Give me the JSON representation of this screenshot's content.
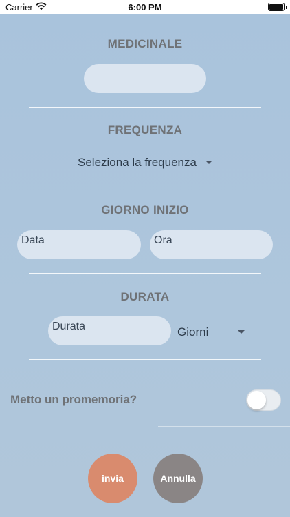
{
  "status_bar": {
    "carrier": "Carrier",
    "time": "6:00 PM",
    "wifi_icon": "wifi-icon",
    "battery_level": 1.0
  },
  "medicine": {
    "title": "MEDICINALE",
    "input_value": "",
    "input_placeholder": ""
  },
  "frequency": {
    "title": "FREQUENZA",
    "selected": "Seleziona la frequenza",
    "icon": "chevron-down-icon"
  },
  "start_day": {
    "title": "GIORNO INIZIO",
    "date_placeholder": "Data",
    "time_placeholder": "Ora"
  },
  "duration": {
    "title": "DURATA",
    "input_placeholder": "Durata",
    "unit_selected": "Giorni",
    "icon": "chevron-down-icon"
  },
  "reminder": {
    "label": "Metto un promemoria?",
    "enabled": false
  },
  "actions": {
    "submit_label": "invia",
    "cancel_label": "Annulla"
  },
  "colors": {
    "background": "#aec6dc",
    "section_title": "#6f7276",
    "input_fill": "#dbe5f0",
    "submit": "#d98b6e",
    "cancel": "#8a8585"
  }
}
